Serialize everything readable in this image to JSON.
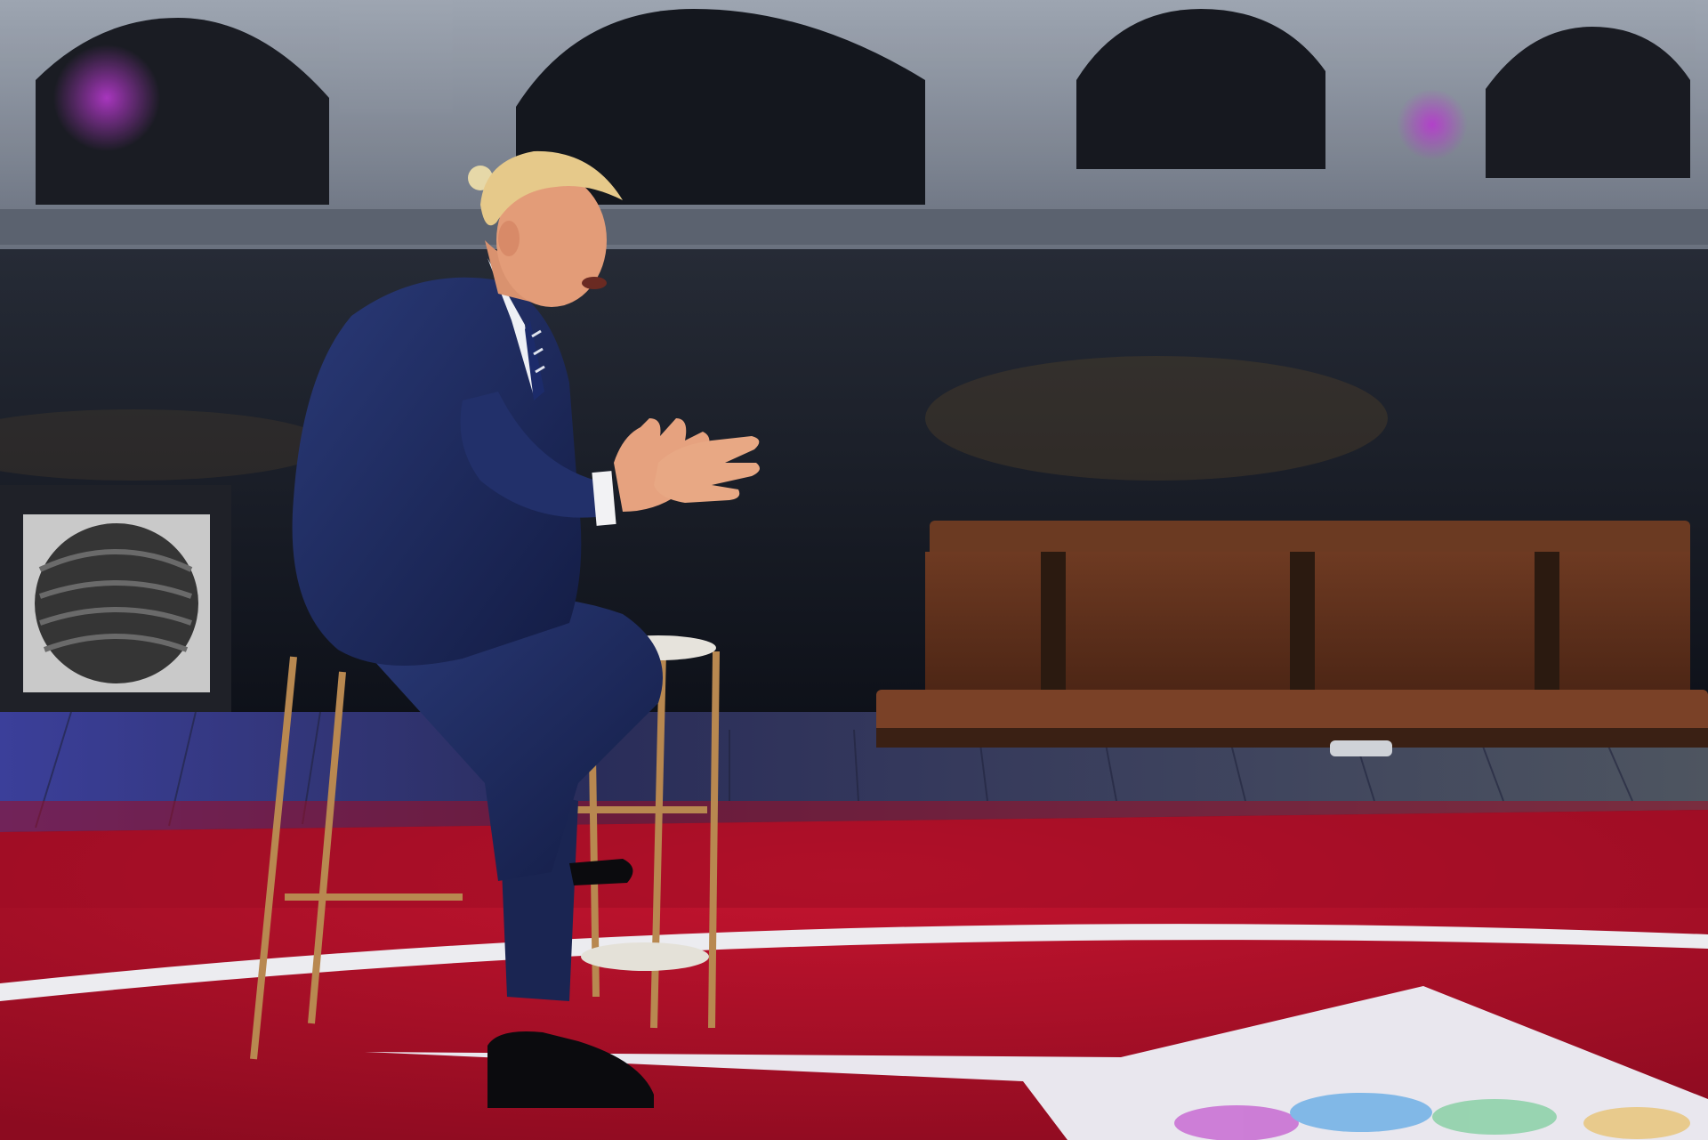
{
  "photo": {
    "subject": "man-in-navy-suit-gesturing",
    "background": "illuminated-arched-bridge-over-river-at-dusk",
    "set": "red-stage-floor-with-white-ring-and-peacock-logo",
    "props": [
      "bar-stool",
      "wooden-bench",
      "wall-artwork-panel"
    ],
    "colors": {
      "sky_water": "#1a2130",
      "bridge": "#8d95a3",
      "stage_red": "#b0102a",
      "suit_navy": "#1c2a5c",
      "bench_wood": "#5a2f1c",
      "floor_ring": "#e8e8ec"
    }
  }
}
